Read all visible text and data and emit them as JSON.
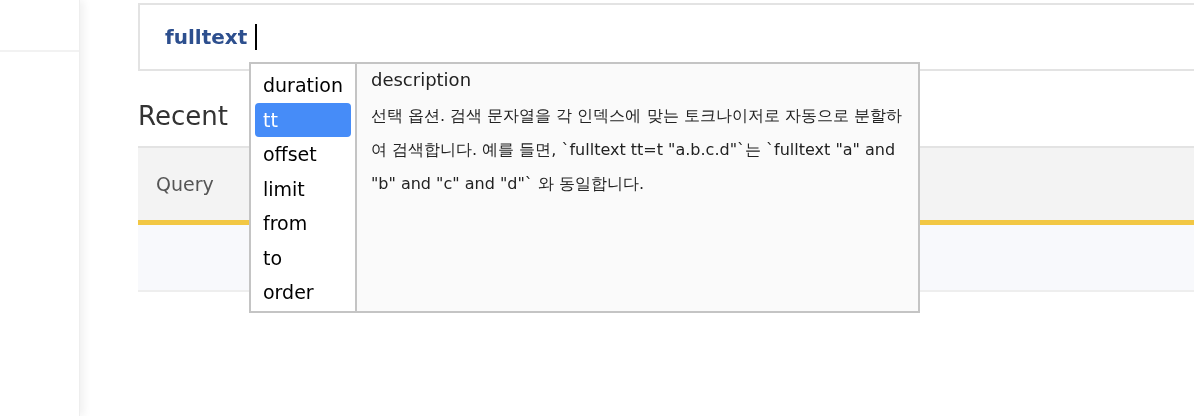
{
  "editor": {
    "value": "fulltext"
  },
  "heading": "Recent",
  "table": {
    "columns": [
      "Query"
    ]
  },
  "autocomplete": {
    "items": [
      {
        "label": "duration",
        "selected": false
      },
      {
        "label": "tt",
        "selected": true
      },
      {
        "label": "offset",
        "selected": false
      },
      {
        "label": "limit",
        "selected": false
      },
      {
        "label": "from",
        "selected": false
      },
      {
        "label": "to",
        "selected": false
      },
      {
        "label": "order",
        "selected": false
      }
    ],
    "description": {
      "title": "description",
      "text": "선택 옵션. 검색 문자열을 각 인덱스에 맞는 토크나이저로 자동으로 분할하여 검색합니다. 예를 들면, `fulltext tt=t \"a.b.c.d\"`는 `fulltext \"a\" and \"b\" and \"c\" and \"d\"` 와 동일합니다."
    }
  }
}
